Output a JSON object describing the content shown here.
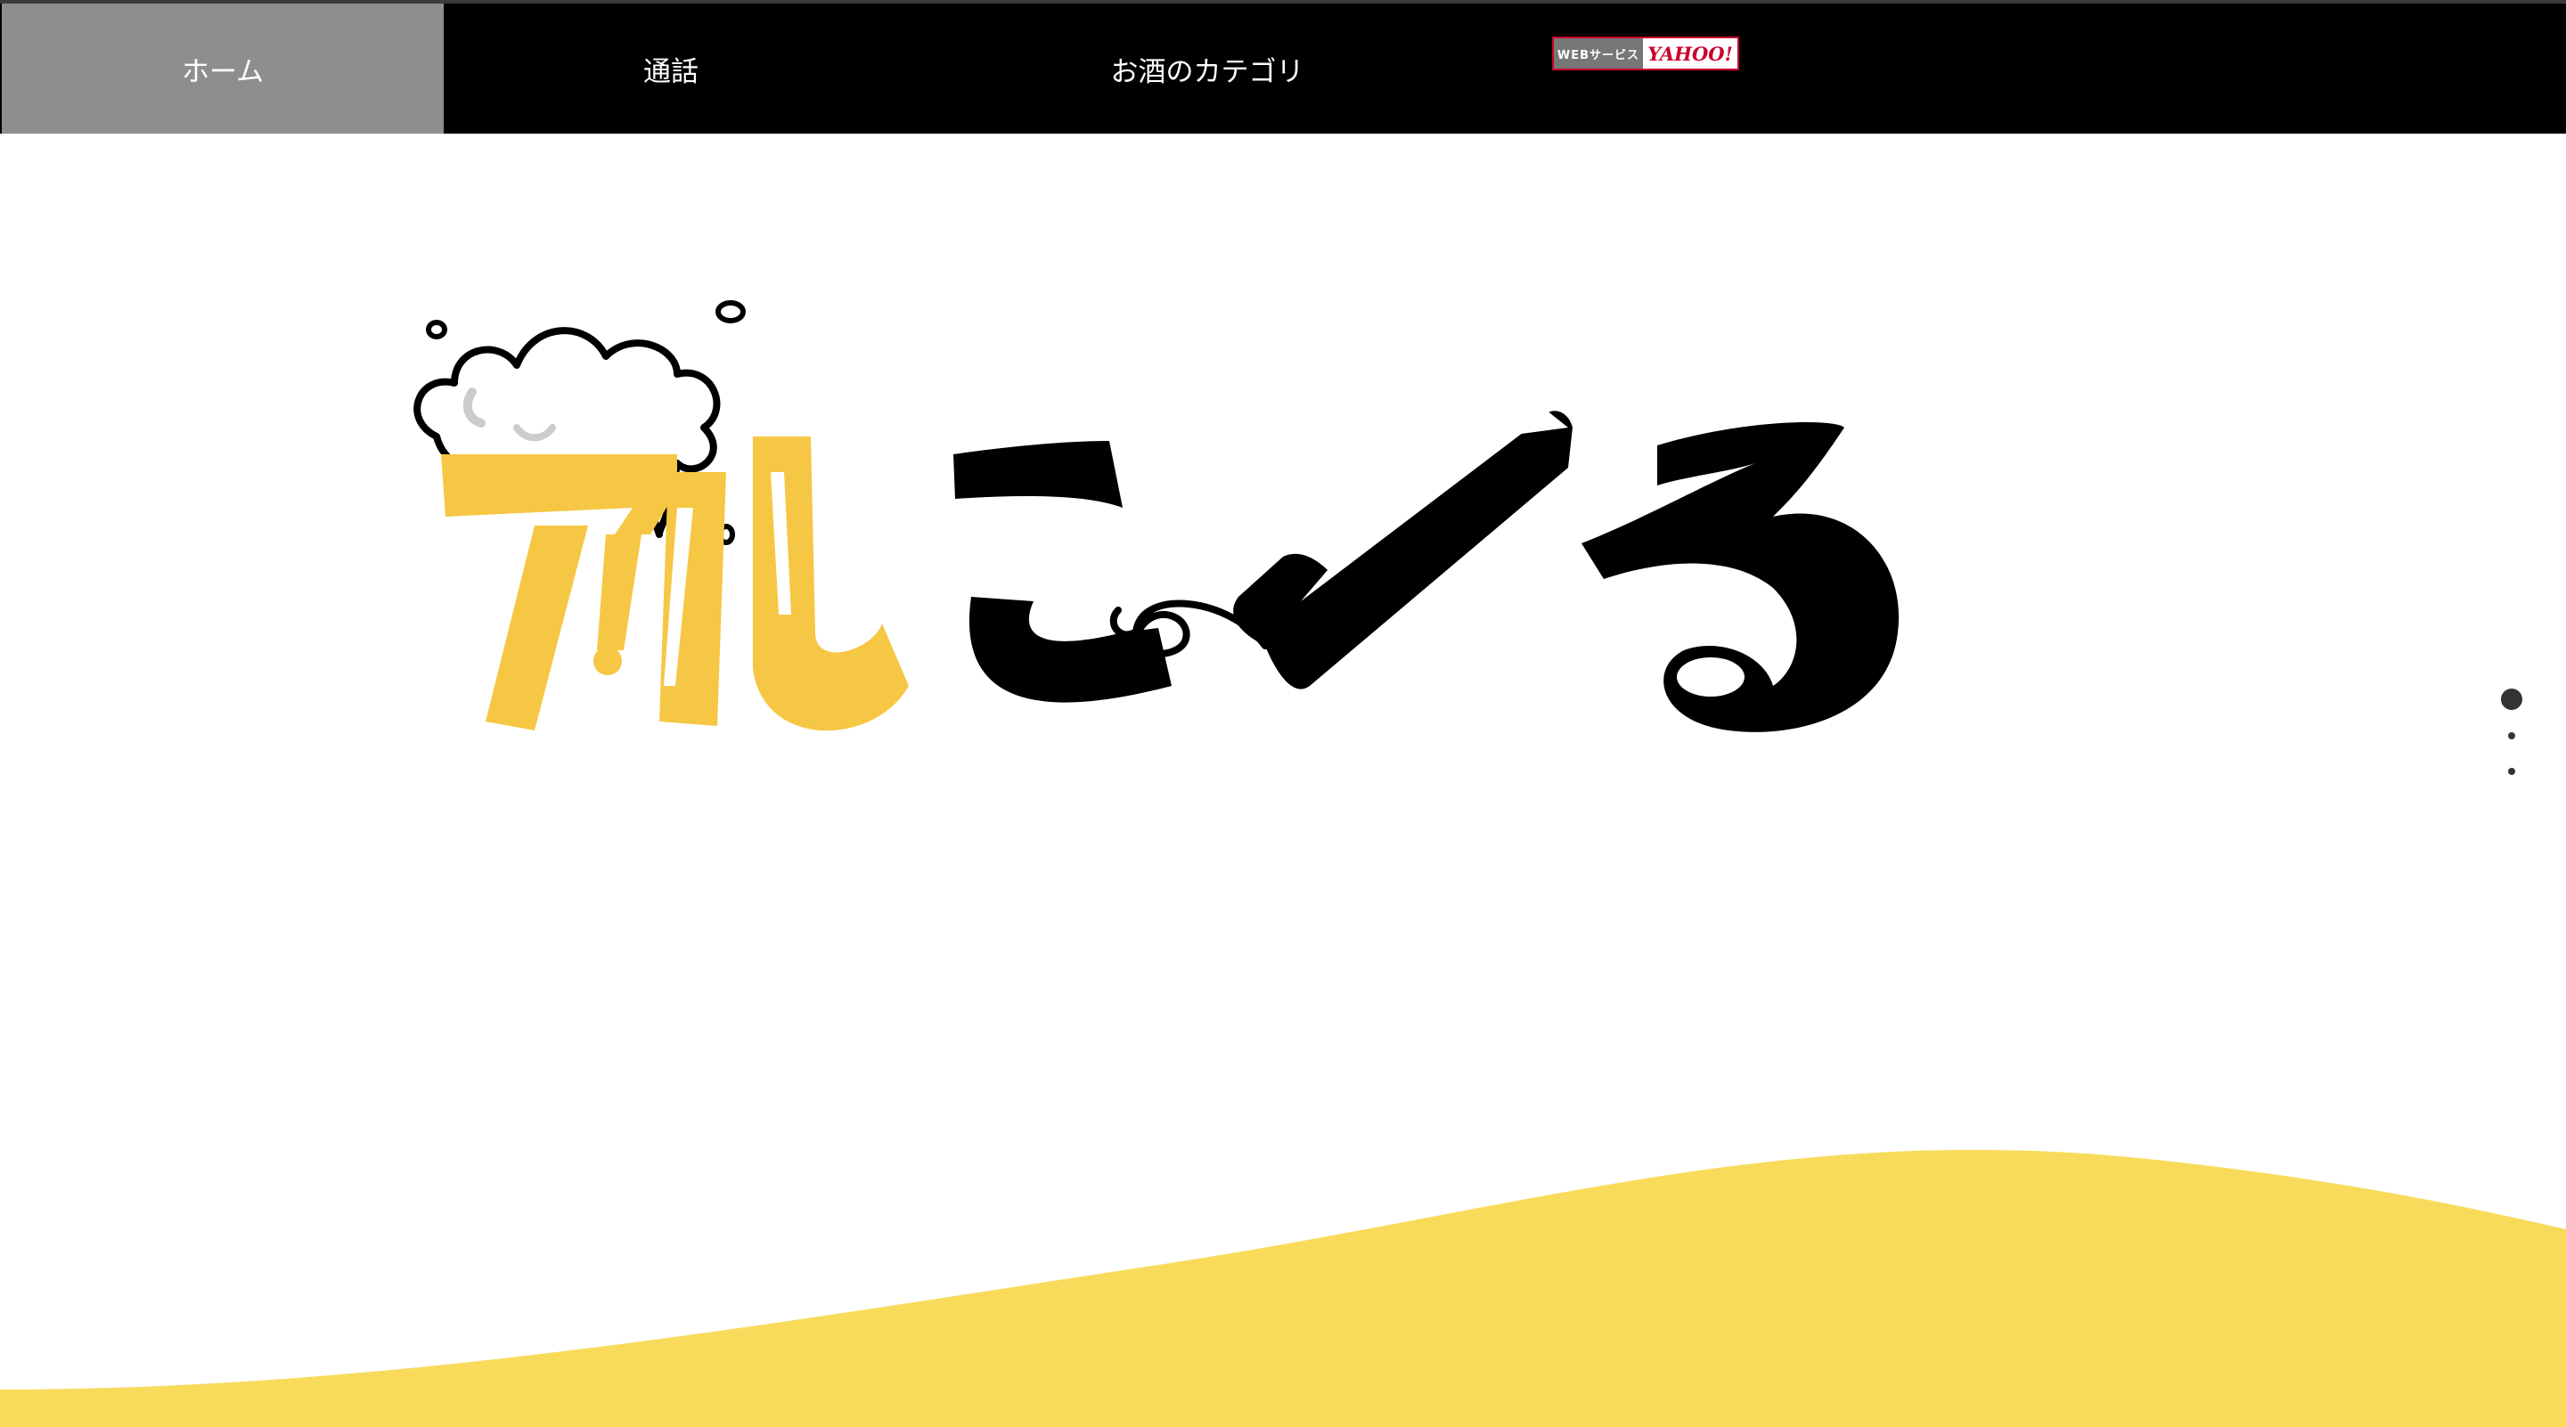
{
  "nav": {
    "items": [
      {
        "label": "ホーム",
        "active": true
      },
      {
        "label": "通話",
        "active": false
      },
      {
        "label": "お酒のカテゴリ",
        "active": false
      }
    ],
    "badge": {
      "left_text": "WEBサービス",
      "right_text": "YAHOO!"
    }
  },
  "hero": {
    "logo_text": "アルこーる"
  },
  "slider": {
    "dots": 3,
    "active_index": 0
  },
  "colors": {
    "nav_bg": "#000000",
    "nav_active_bg": "#8e8e8e",
    "logo_yellow": "#f6c744",
    "wave_yellow": "#f9db5c",
    "text_black": "#000000"
  }
}
